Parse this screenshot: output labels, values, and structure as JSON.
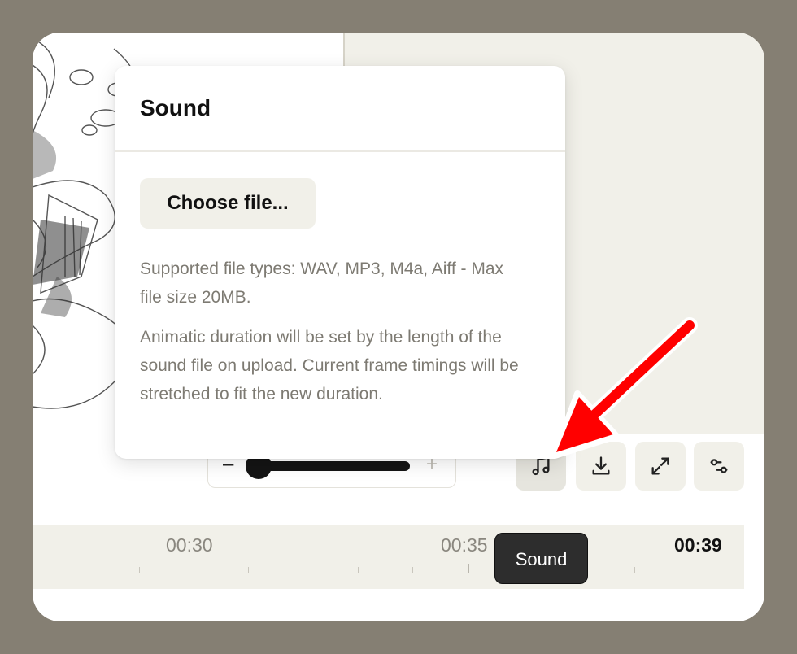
{
  "popover": {
    "title": "Sound",
    "choose_button": "Choose file...",
    "supported_types": "Supported file types: WAV, MP3, M4a, Aiff - Max file size 20MB.",
    "duration_note": "Animatic duration will be set by the length of the sound file on upload. Current frame timings will be stretched to fit the new duration."
  },
  "zoom": {
    "minus": "–",
    "plus": "+",
    "level": 0.05
  },
  "toolbar": {
    "buttons": [
      {
        "icon": "music-note-icon",
        "label": "Sound"
      },
      {
        "icon": "download-icon"
      },
      {
        "icon": "expand-icon"
      },
      {
        "icon": "sliders-icon"
      }
    ]
  },
  "tooltip": {
    "text": "Sound"
  },
  "timeline": {
    "labels": [
      "00:30",
      "00:35",
      "00:39"
    ]
  },
  "colors": {
    "backdrop": "#857f73",
    "panel": "#f1f0e9",
    "annotation_arrow": "#ff0000"
  }
}
